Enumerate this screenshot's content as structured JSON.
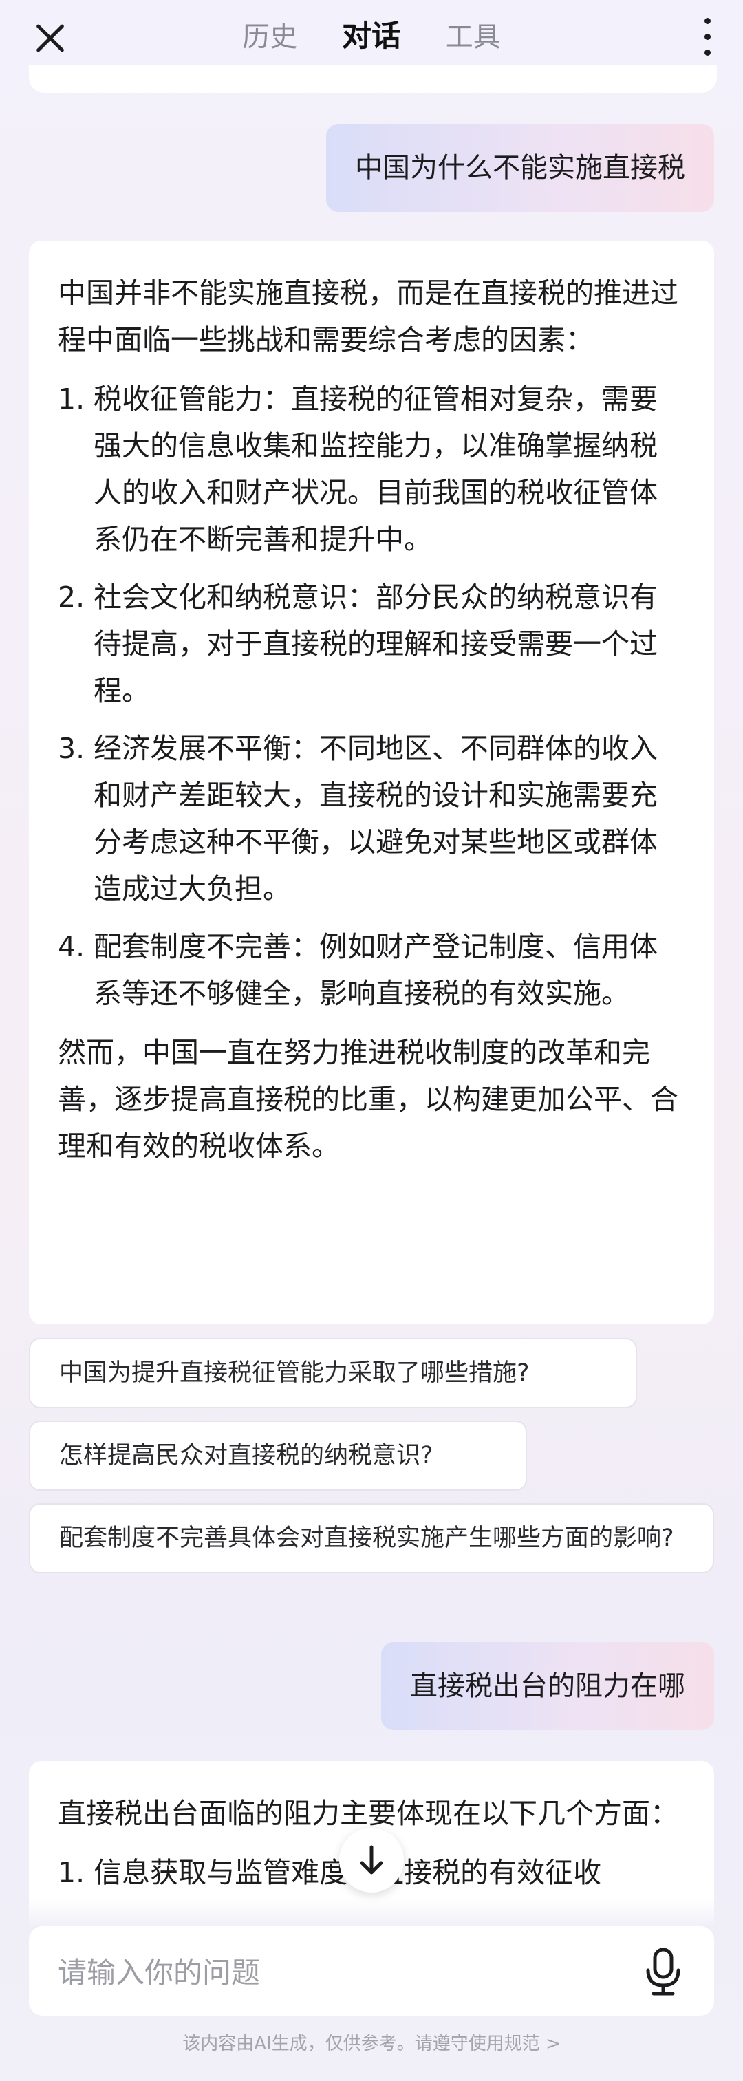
{
  "header": {
    "tabs": [
      {
        "label": "历史"
      },
      {
        "label": "对话"
      },
      {
        "label": "工具"
      }
    ]
  },
  "messages": {
    "user1": "中国为什么不能实施直接税",
    "ai1": {
      "intro": "中国并非不能实施直接税，而是在直接税的推进过程中面临一些挑战和需要综合考虑的因素：",
      "items": [
        {
          "num": "1.",
          "text": "税收征管能力：直接税的征管相对复杂，需要强大的信息收集和监控能力，以准确掌握纳税人的收入和财产状况。目前我国的税收征管体系仍在不断完善和提升中。"
        },
        {
          "num": "2.",
          "text": "社会文化和纳税意识：部分民众的纳税意识有待提高，对于直接税的理解和接受需要一个过程。"
        },
        {
          "num": "3.",
          "text": "经济发展不平衡：不同地区、不同群体的收入和财产差距较大，直接税的设计和实施需要充分考虑这种不平衡，以避免对某些地区或群体造成过大负担。"
        },
        {
          "num": "4.",
          "text": "配套制度不完善：例如财产登记制度、信用体系等还不够健全，影响直接税的有效实施。"
        }
      ],
      "conclusion": "然而，中国一直在努力推进税收制度的改革和完善，逐步提高直接税的比重，以构建更加公平、合理和有效的税收体系。"
    },
    "suggestions": [
      "中国为提升直接税征管能力采取了哪些措施?",
      "怎样提高民众对直接税的纳税意识?",
      "配套制度不完善具体会对直接税实施产生哪些方面的影响?"
    ],
    "user2": "直接税出台的阻力在哪",
    "ai2": {
      "intro": "直接税出台面临的阻力主要体现在以下几个方面：",
      "partial": "1. 信息获取与监管难度：直接税的有效征收"
    }
  },
  "input": {
    "placeholder": "请输入你的问题"
  },
  "footer": {
    "note": "该内容由AI生成，仅供参考。请遵守使用规范 >"
  },
  "colors": {
    "user_bubble_start": "#d9def8",
    "user_bubble_end": "#f6dfe9",
    "card": "#ffffff",
    "placeholder": "#9d9da4"
  }
}
